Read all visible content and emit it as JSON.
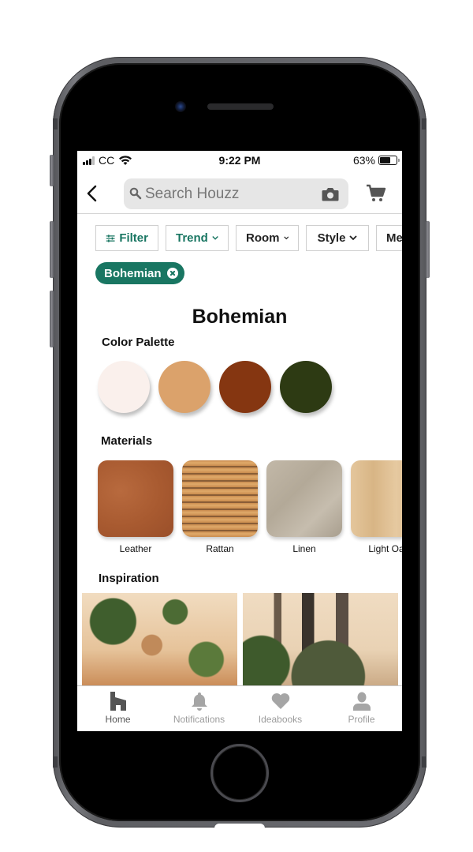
{
  "status_bar": {
    "carrier": "CC",
    "time": "9:22 PM",
    "battery_percent": "63%",
    "battery_level": 0.63
  },
  "header": {
    "search_placeholder": "Search Houzz",
    "icons": [
      "back-chevron-icon",
      "search-icon",
      "camera-icon",
      "cart-icon"
    ]
  },
  "filters": {
    "chips": [
      {
        "label": "Filter",
        "icon": "sliders-icon",
        "accent": true
      },
      {
        "label": "Trend",
        "dropdown": true,
        "accent": true
      },
      {
        "label": "Room",
        "dropdown": true,
        "accent": false
      },
      {
        "label": "Style",
        "dropdown": true,
        "accent": false
      },
      {
        "label": "Me",
        "dropdown": false,
        "accent": false
      }
    ],
    "active_tag": "Bohemian"
  },
  "page": {
    "title": "Bohemian",
    "color_palette_label": "Color Palette",
    "palette": [
      "#faf0ec",
      "#dba26b",
      "#853611",
      "#2d3a13"
    ],
    "materials_label": "Materials",
    "materials": [
      {
        "label": "Leather"
      },
      {
        "label": "Rattan"
      },
      {
        "label": "Linen"
      },
      {
        "label": "Light Oak"
      }
    ],
    "inspiration_label": "Inspiration",
    "inspiration": [
      {
        "description": "plant-filled bohemian corner with shelves"
      },
      {
        "description": "gallery wall above green sofa"
      }
    ]
  },
  "tabbar": {
    "tabs": [
      {
        "label": "Home",
        "icon": "houzz-home-icon",
        "active": true
      },
      {
        "label": "Notifications",
        "icon": "bell-icon",
        "active": false
      },
      {
        "label": "Ideabooks",
        "icon": "heart-icon",
        "active": false
      },
      {
        "label": "Profile",
        "icon": "person-icon",
        "active": false
      }
    ]
  },
  "colors": {
    "accent": "#197662",
    "tab_active": "#555555",
    "tab_inactive": "#9b9b9b"
  }
}
